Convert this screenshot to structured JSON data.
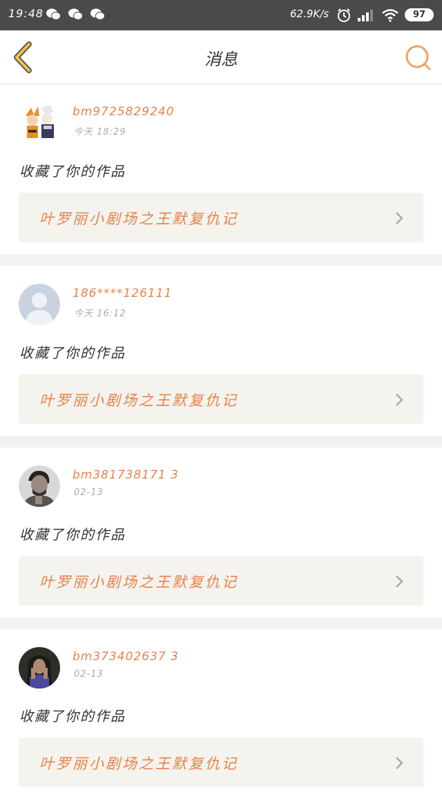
{
  "status_bar": {
    "time": "19:48",
    "net_speed": "62.9K/s",
    "battery": "97",
    "icons": [
      "wechat-icon",
      "wechat-icon",
      "wechat-icon",
      "alarm-icon",
      "signal-icon",
      "wifi-icon",
      "battery-icon"
    ]
  },
  "header": {
    "title": "消息",
    "back_icon": "back-chevron-icon",
    "search_icon": "search-icon",
    "accent": "#f0a060"
  },
  "colors": {
    "accent": "#e8824a",
    "card_bg": "#ffffff",
    "page_bg": "#f2f2f0",
    "work_bg": "#f4f3ee"
  },
  "messages": [
    {
      "user": "bm9725829240",
      "time": "今天 18:29",
      "action": "收藏了你的作品",
      "work_title": "叶罗丽小剧场之王默复仇记",
      "avatar": "anime-characters-avatar"
    },
    {
      "user": "186****126111",
      "time": "今天 16:12",
      "action": "收藏了你的作品",
      "work_title": "叶罗丽小剧场之王默复仇记",
      "avatar": "default-user-avatar"
    },
    {
      "user": "bm381738171 3",
      "time": "02-13",
      "action": "收藏了你的作品",
      "work_title": "叶罗丽小剧场之王默复仇记",
      "avatar": "man-photo-avatar"
    },
    {
      "user": "bm373402637 3",
      "time": "02-13",
      "action": "收藏了你的作品",
      "work_title": "叶罗丽小剧场之王默复仇记",
      "avatar": "woman-photo-avatar"
    }
  ]
}
